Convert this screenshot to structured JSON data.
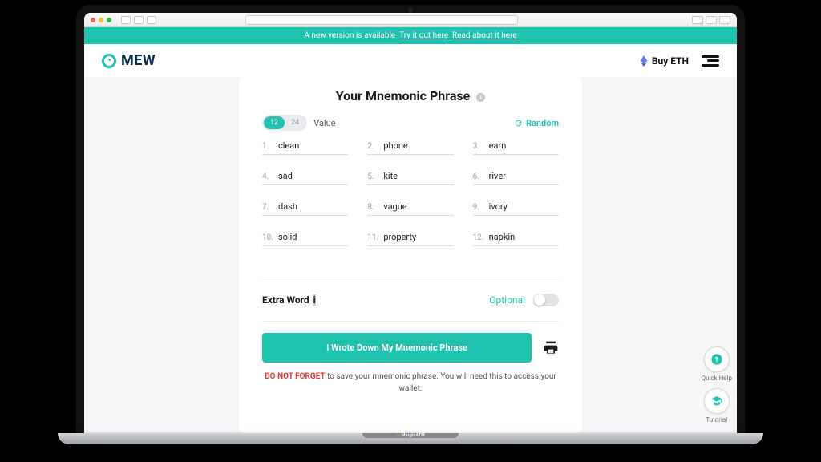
{
  "banner": {
    "text": "A new version is available",
    "try_link": "Try it out here",
    "read_link": "Read about it here"
  },
  "header": {
    "logo_text": "MEW",
    "buy_label": "Buy ETH"
  },
  "card": {
    "title": "Your Mnemonic Phrase",
    "toggle": {
      "opt12": "12",
      "opt24": "24"
    },
    "value_label": "Value",
    "random_label": "Random",
    "words": [
      {
        "n": "1.",
        "w": "clean"
      },
      {
        "n": "2.",
        "w": "phone"
      },
      {
        "n": "3.",
        "w": "earn"
      },
      {
        "n": "4.",
        "w": "sad"
      },
      {
        "n": "5.",
        "w": "kite"
      },
      {
        "n": "6.",
        "w": "river"
      },
      {
        "n": "7.",
        "w": "dash"
      },
      {
        "n": "8.",
        "w": "vague"
      },
      {
        "n": "9.",
        "w": "ivory"
      },
      {
        "n": "10.",
        "w": "solid"
      },
      {
        "n": "11.",
        "w": "property"
      },
      {
        "n": "12.",
        "w": "napkin"
      }
    ],
    "extra_label": "Extra Word",
    "optional_label": "Optional",
    "primary_button": "I Wrote Down My Mnemonic Phrase",
    "warning_strong": "DO NOT FORGET",
    "warning_rest": " to save your mnemonic phrase. You will need this to access your wallet."
  },
  "help": {
    "quick": "Quick Help",
    "tutorial": "Tutorial"
  },
  "watermark": "MarginATM"
}
